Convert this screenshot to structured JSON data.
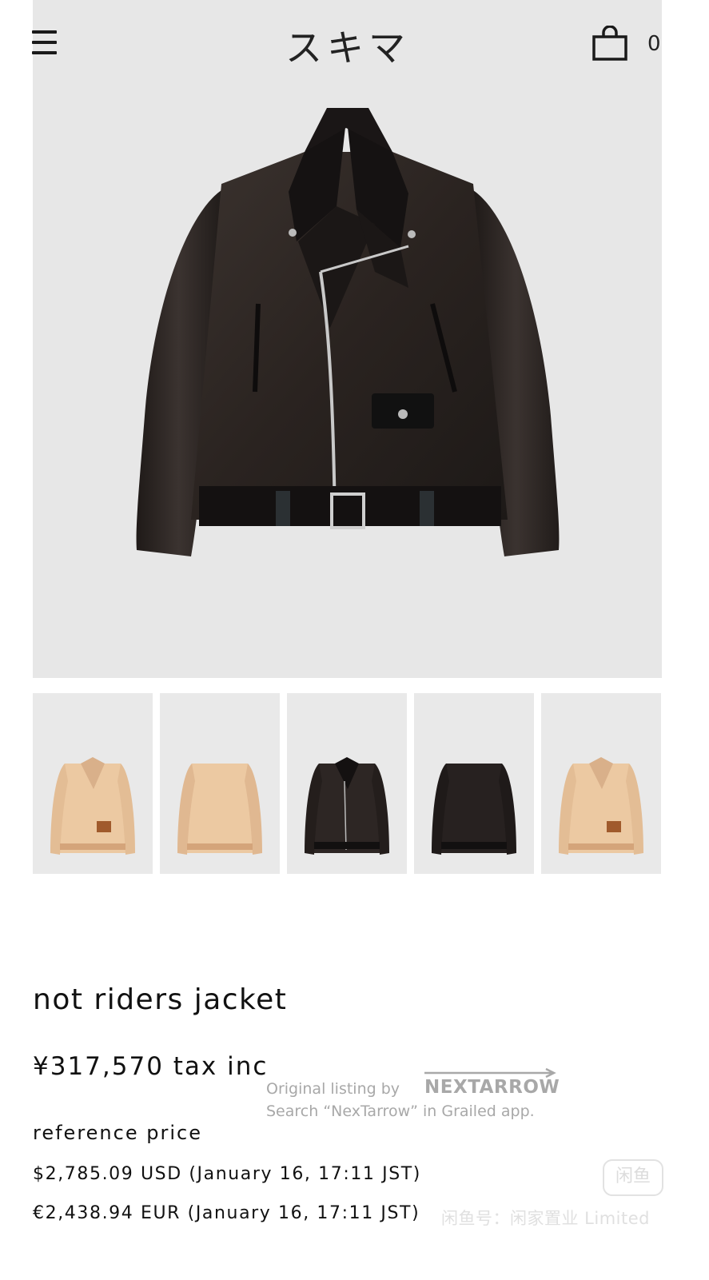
{
  "header": {
    "brand": "スキマ",
    "cart_count": "0",
    "menu_icon": "hamburger-icon",
    "cart_icon": "shopping-bag-icon"
  },
  "gallery": {
    "main_image": "black-leather-riders-jacket",
    "thumbnails": [
      {
        "image": "tan-riders-jacket-front"
      },
      {
        "image": "tan-riders-jacket-back"
      },
      {
        "image": "black-riders-jacket-front"
      },
      {
        "image": "black-riders-jacket-back"
      },
      {
        "image": "tan-riders-jacket-angle"
      }
    ]
  },
  "product": {
    "title": "not riders jacket",
    "price": "¥317,570 tax inc",
    "reference_label": "reference price",
    "reference_usd": "$2,785.09 USD (January 16, 17:11 JST)",
    "reference_eur": "€2,438.94 EUR (January 16, 17:11 JST)"
  },
  "watermark": {
    "listing": "Original listing by",
    "brand": "NEXTARROW",
    "search": "Search “NexTarrow” in Grailed app.",
    "logo": "闲鱼",
    "id": "闲鱼号：闲家置业 Limited"
  },
  "colors": {
    "background": "#ffffff",
    "photo_bg": "#e7e7e7",
    "text": "#111111",
    "black_leather": "#2b2523",
    "tan_leather": "#e9c9a4",
    "watermark": "#a8a8a8"
  }
}
